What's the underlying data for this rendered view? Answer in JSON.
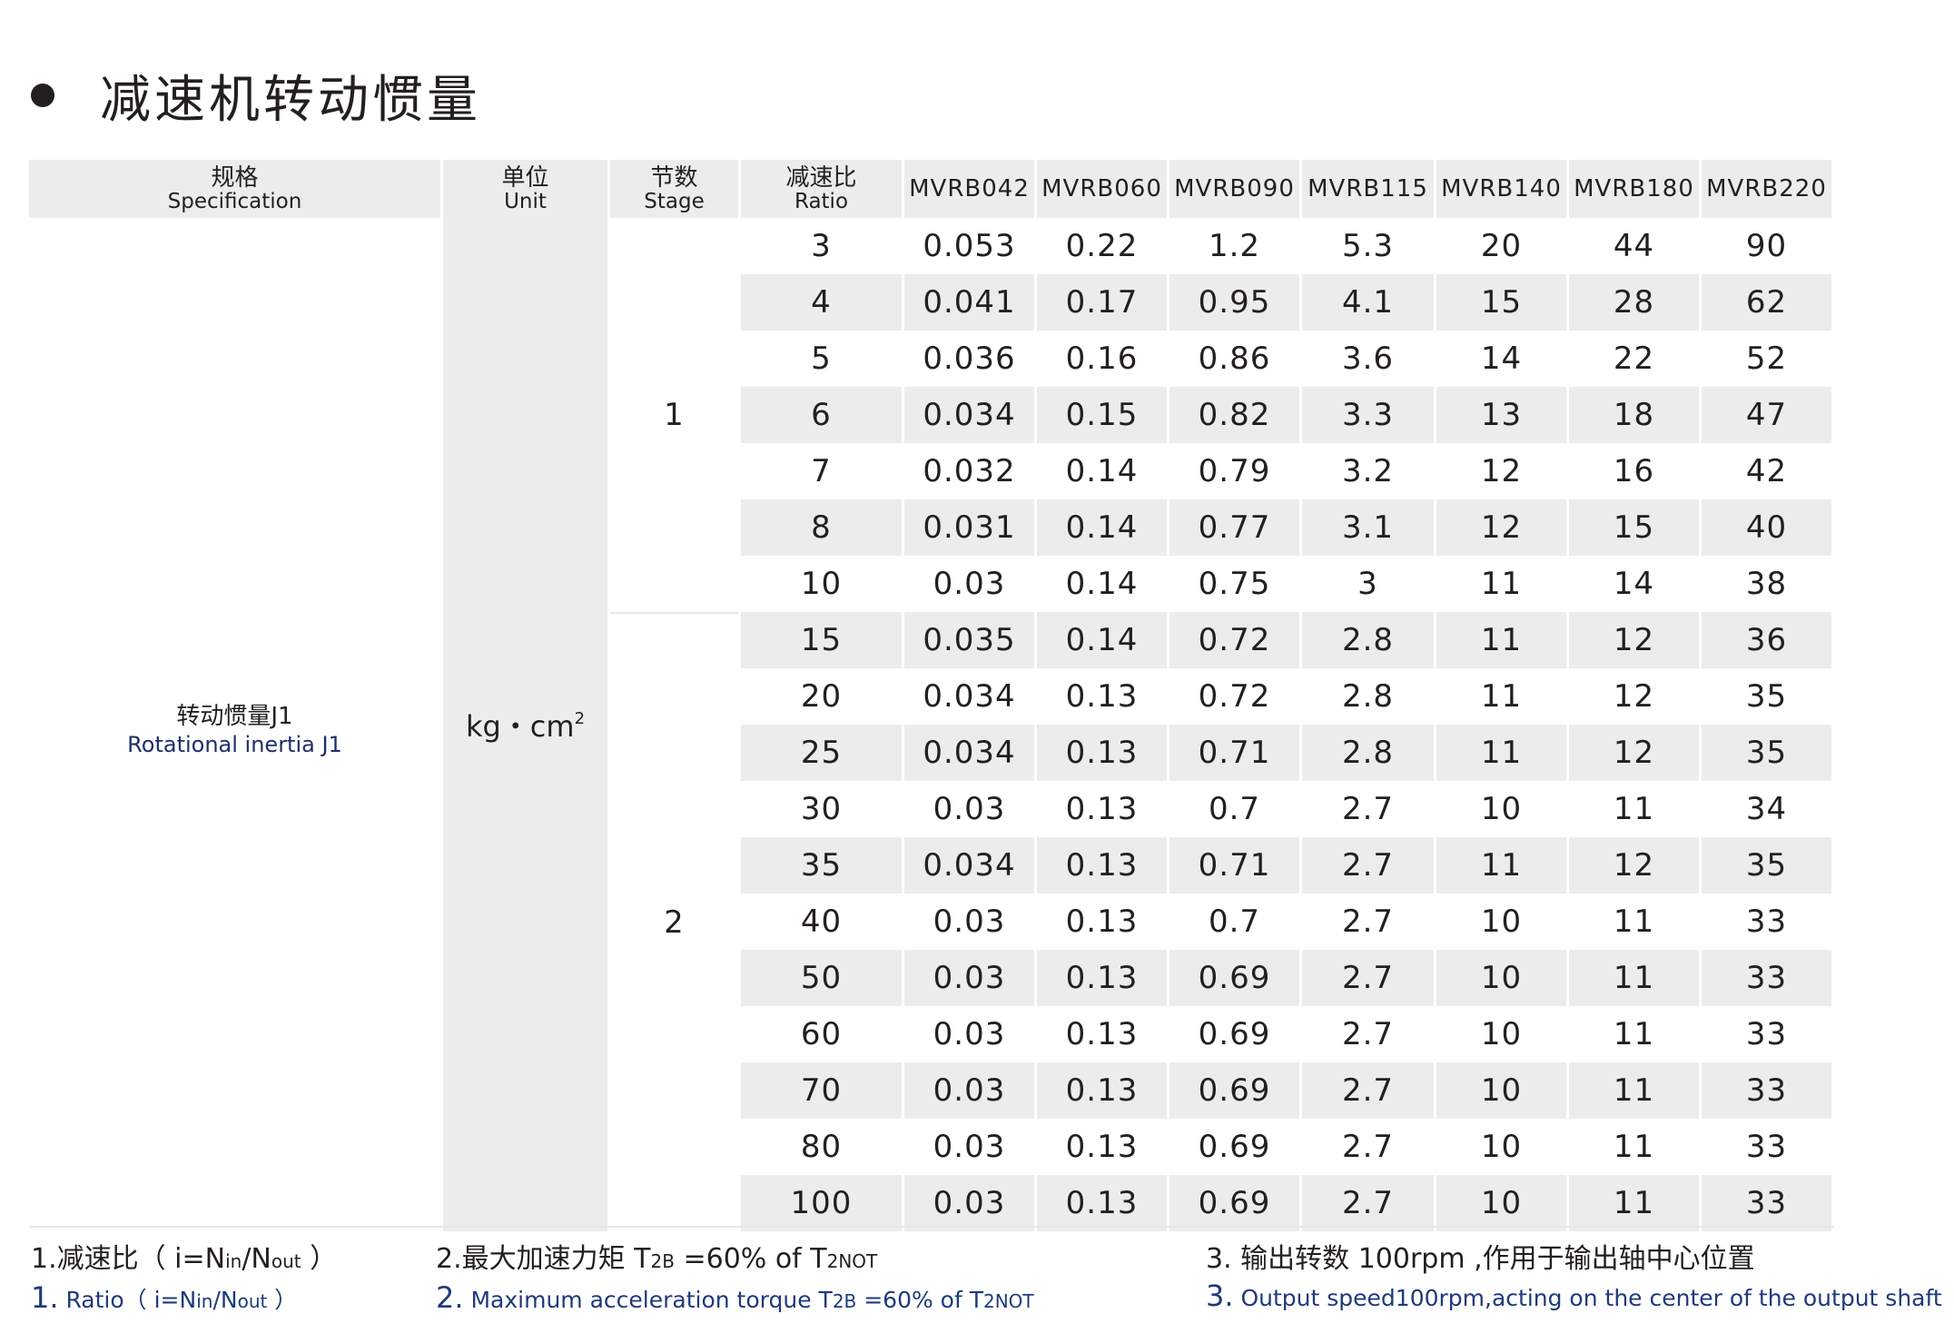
{
  "title": "减速机转动惯量",
  "headers": {
    "spec_zh": "规格",
    "spec_en": "Specification",
    "unit_zh": "单位",
    "unit_en": "Unit",
    "stage_zh": "节数",
    "stage_en": "Stage",
    "ratio_zh": "减速比",
    "ratio_en": "Ratio"
  },
  "models": [
    "MVRB042",
    "MVRB060",
    "MVRB090",
    "MVRB115",
    "MVRB140",
    "MVRB180",
    "MVRB220"
  ],
  "spec_zh": "转动惯量J1",
  "spec_en": "Rotational inertia J1",
  "unit_base": "kg・cm",
  "unit_exp": "2",
  "stages": [
    "1",
    "2"
  ],
  "rows": [
    {
      "ratio": "3",
      "v": [
        "0.053",
        "0.22",
        "1.2",
        "5.3",
        "20",
        "44",
        "90"
      ]
    },
    {
      "ratio": "4",
      "v": [
        "0.041",
        "0.17",
        "0.95",
        "4.1",
        "15",
        "28",
        "62"
      ]
    },
    {
      "ratio": "5",
      "v": [
        "0.036",
        "0.16",
        "0.86",
        "3.6",
        "14",
        "22",
        "52"
      ]
    },
    {
      "ratio": "6",
      "v": [
        "0.034",
        "0.15",
        "0.82",
        "3.3",
        "13",
        "18",
        "47"
      ]
    },
    {
      "ratio": "7",
      "v": [
        "0.032",
        "0.14",
        "0.79",
        "3.2",
        "12",
        "16",
        "42"
      ]
    },
    {
      "ratio": "8",
      "v": [
        "0.031",
        "0.14",
        "0.77",
        "3.1",
        "12",
        "15",
        "40"
      ]
    },
    {
      "ratio": "10",
      "v": [
        "0.03",
        "0.14",
        "0.75",
        "3",
        "11",
        "14",
        "38"
      ]
    },
    {
      "ratio": "15",
      "v": [
        "0.035",
        "0.14",
        "0.72",
        "2.8",
        "11",
        "12",
        "36"
      ]
    },
    {
      "ratio": "20",
      "v": [
        "0.034",
        "0.13",
        "0.72",
        "2.8",
        "11",
        "12",
        "35"
      ]
    },
    {
      "ratio": "25",
      "v": [
        "0.034",
        "0.13",
        "0.71",
        "2.8",
        "11",
        "12",
        "35"
      ]
    },
    {
      "ratio": "30",
      "v": [
        "0.03",
        "0.13",
        "0.7",
        "2.7",
        "10",
        "11",
        "34"
      ]
    },
    {
      "ratio": "35",
      "v": [
        "0.034",
        "0.13",
        "0.71",
        "2.7",
        "11",
        "12",
        "35"
      ]
    },
    {
      "ratio": "40",
      "v": [
        "0.03",
        "0.13",
        "0.7",
        "2.7",
        "10",
        "11",
        "33"
      ]
    },
    {
      "ratio": "50",
      "v": [
        "0.03",
        "0.13",
        "0.69",
        "2.7",
        "10",
        "11",
        "33"
      ]
    },
    {
      "ratio": "60",
      "v": [
        "0.03",
        "0.13",
        "0.69",
        "2.7",
        "10",
        "11",
        "33"
      ]
    },
    {
      "ratio": "70",
      "v": [
        "0.03",
        "0.13",
        "0.69",
        "2.7",
        "10",
        "11",
        "33"
      ]
    },
    {
      "ratio": "80",
      "v": [
        "0.03",
        "0.13",
        "0.69",
        "2.7",
        "10",
        "11",
        "33"
      ]
    },
    {
      "ratio": "100",
      "v": [
        "0.03",
        "0.13",
        "0.69",
        "2.7",
        "10",
        "11",
        "33"
      ]
    }
  ],
  "notes": {
    "n1": {
      "zh_prefix": "1.减速比（ i=N",
      "zh_sub1": "in",
      "zh_mid": "/N",
      "zh_sub2": "out",
      "zh_suffix": " ）",
      "en_num": "1.",
      "en_prefix": " Ratio（ i=N",
      "en_sub1": "in",
      "en_mid": "/N",
      "en_sub2": "out",
      "en_suffix": " ）"
    },
    "n2": {
      "zh_prefix": "2.最大加速力矩 T",
      "zh_sub1": "2B",
      "zh_mid": " =60% of T",
      "zh_sub2": "2NOT",
      "en_num": "2.",
      "en_prefix": " Maximum acceleration torque T",
      "en_sub1": "2B",
      "en_mid": " =60%  of  T",
      "en_sub2": "2NOT"
    },
    "n3": {
      "zh": "3. 输出转数 100rpm ,作用于输出轴中心位置",
      "en_num": "3.",
      "en_text": " Output speed100rpm,acting on the center of the output shaft"
    }
  }
}
